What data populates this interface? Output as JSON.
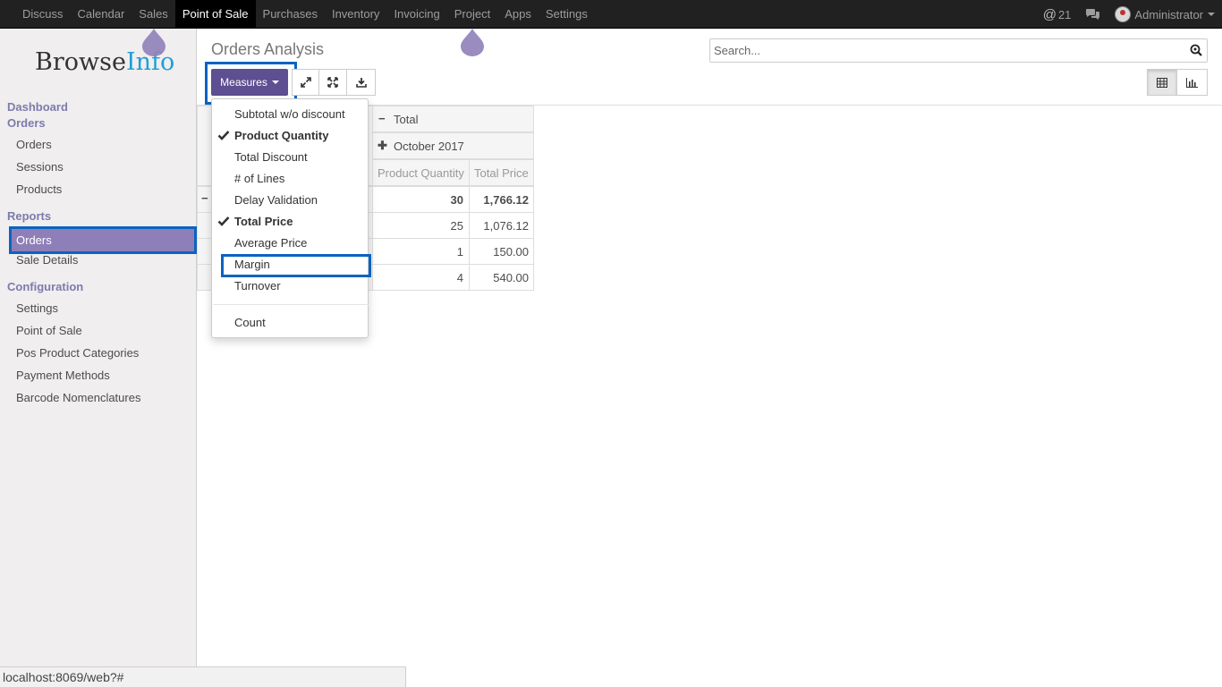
{
  "topbar": {
    "menu": [
      "Discuss",
      "Calendar",
      "Sales",
      "Point of Sale",
      "Purchases",
      "Inventory",
      "Invoicing",
      "Project",
      "Apps",
      "Settings"
    ],
    "active_index": 3,
    "mentions_count": "21",
    "user_name": "Administrator"
  },
  "logo": {
    "part1": "Browse",
    "part2": "Info"
  },
  "sidebar": {
    "dashboard": "Dashboard",
    "orders_heading": "Orders",
    "orders_items": [
      "Orders",
      "Sessions",
      "Products"
    ],
    "reports_heading": "Reports",
    "reports_items": [
      "Orders",
      "Sale Details"
    ],
    "configuration_heading": "Configuration",
    "configuration_items": [
      "Settings",
      "Point of Sale",
      "Pos Product Categories",
      "Payment Methods",
      "Barcode Nomenclatures"
    ]
  },
  "page": {
    "title": "Orders Analysis",
    "search_placeholder": "Search...",
    "measures_label": "Measures"
  },
  "pivot": {
    "col_total": "Total",
    "col_group": "October 2017",
    "measure_headers": [
      "Product Quantity",
      "Total Price"
    ],
    "rows": [
      {
        "qty": "30",
        "price": "1,766.12",
        "bold": true
      },
      {
        "qty": "25",
        "price": "1,076.12"
      },
      {
        "qty": "1",
        "price": "150.00"
      },
      {
        "qty": "4",
        "price": "540.00"
      }
    ]
  },
  "measures_menu": {
    "items": [
      {
        "label": "Subtotal w/o discount",
        "checked": false
      },
      {
        "label": "Product Quantity",
        "checked": true
      },
      {
        "label": "Total Discount",
        "checked": false
      },
      {
        "label": "# of Lines",
        "checked": false
      },
      {
        "label": "Delay Validation",
        "checked": false
      },
      {
        "label": "Total Price",
        "checked": true
      },
      {
        "label": "Average Price",
        "checked": false
      },
      {
        "label": "Margin",
        "checked": false
      },
      {
        "label": "Turnover",
        "checked": false
      }
    ],
    "count_label": "Count"
  },
  "statusbar": {
    "url": "localhost:8069/web?#"
  },
  "colors": {
    "brand": "#7c7bad",
    "button": "#5d4f91",
    "highlight": "#0b63c0"
  }
}
